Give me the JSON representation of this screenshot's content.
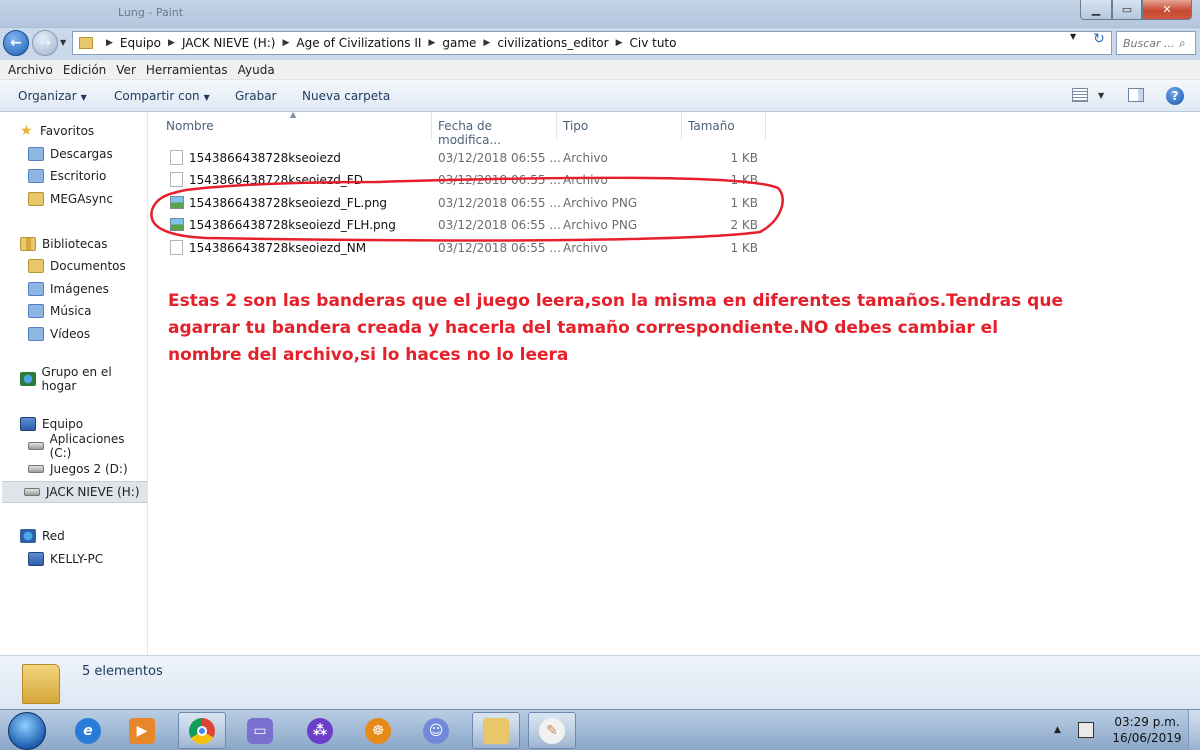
{
  "window": {
    "title": "Lung - Paint"
  },
  "address": {
    "breadcrumbs": [
      "Equipo",
      "JACK NIEVE (H:)",
      "Age of Civilizations II",
      "game",
      "civilizations_editor",
      "Civ tuto"
    ],
    "search_placeholder": "Buscar ..."
  },
  "menu": {
    "items": [
      "Archivo",
      "Edición",
      "Ver",
      "Herramientas",
      "Ayuda"
    ]
  },
  "toolbar": {
    "organizar": "Organizar",
    "compartir": "Compartir con",
    "grabar": "Grabar",
    "nueva_carpeta": "Nueva carpeta"
  },
  "sidebar": {
    "favoritos": "Favoritos",
    "descargas": "Descargas",
    "escritorio": "Escritorio",
    "megasync": "MEGAsync",
    "bibliotecas": "Bibliotecas",
    "documentos": "Documentos",
    "imagenes": "Imágenes",
    "musica": "Música",
    "videos": "Vídeos",
    "grupo_hogar": "Grupo en el hogar",
    "equipo": "Equipo",
    "aplicaciones": "Aplicaciones (C:)",
    "juegos": "Juegos 2 (D:)",
    "jack": "JACK NIEVE (H:)",
    "red": "Red",
    "kelly": "KELLY-PC"
  },
  "columns": {
    "name": "Nombre",
    "date": "Fecha de modifica...",
    "type": "Tipo",
    "size": "Tamaño"
  },
  "files": [
    {
      "name": "1543866438728kseoiezd",
      "date": "03/12/2018 06:55 ...",
      "type": "Archivo",
      "size": "1 KB",
      "kind": "file"
    },
    {
      "name": "1543866438728kseoiezd_FD",
      "date": "03/12/2018 06:55 ...",
      "type": "Archivo",
      "size": "1 KB",
      "kind": "file"
    },
    {
      "name": "1543866438728kseoiezd_FL.png",
      "date": "03/12/2018 06:55 ...",
      "type": "Archivo PNG",
      "size": "1 KB",
      "kind": "png"
    },
    {
      "name": "1543866438728kseoiezd_FLH.png",
      "date": "03/12/2018 06:55 ...",
      "type": "Archivo PNG",
      "size": "2 KB",
      "kind": "png"
    },
    {
      "name": "1543866438728kseoiezd_NM",
      "date": "03/12/2018 06:55 ...",
      "type": "Archivo",
      "size": "1 KB",
      "kind": "file"
    }
  ],
  "annotation": {
    "text": "Estas 2 son las banderas que el juego leera,son la misma en diferentes tamaños.Tendras que agarrar tu bandera creada y hacerla del tamaño correspondiente.NO debes cambiar el nombre del archivo,si lo haces no lo leera",
    "color": "#e5202b"
  },
  "status": {
    "count": "5 elementos"
  },
  "taskbar": {
    "time": "03:29 p.m.",
    "date": "16/06/2019"
  }
}
